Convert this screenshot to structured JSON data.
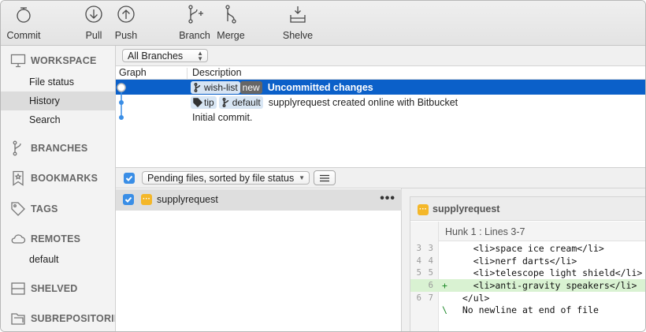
{
  "toolbar": {
    "commit": "Commit",
    "pull": "Pull",
    "push": "Push",
    "branch": "Branch",
    "merge": "Merge",
    "shelve": "Shelve"
  },
  "sidebar": {
    "workspace": "WORKSPACE",
    "file_status": "File status",
    "history": "History",
    "search": "Search",
    "branches": "BRANCHES",
    "bookmarks": "BOOKMARKS",
    "tags": "TAGS",
    "remotes": "REMOTES",
    "remote_default": "default",
    "shelved": "SHELVED",
    "subrepositories": "SUBREPOSITORIE"
  },
  "history": {
    "branch_filter": "All Branches",
    "col_graph": "Graph",
    "col_description": "Description",
    "rows": [
      {
        "tags": [
          "wish-list",
          "new"
        ],
        "message": "Uncommitted changes",
        "selected": true
      },
      {
        "tags": [
          "tip",
          "default"
        ],
        "message": "supplyrequest created online with Bitbucket",
        "selected": false
      },
      {
        "tags": [],
        "message": "Initial commit.",
        "selected": false
      }
    ]
  },
  "pending": {
    "filter_label": "Pending files, sorted by file status",
    "files": [
      {
        "name": "supplyrequest",
        "checked": true,
        "status": "modified",
        "menu": "•••"
      }
    ]
  },
  "diff": {
    "file": "supplyrequest",
    "hunk": "Hunk 1 : Lines 3-7",
    "lines": [
      {
        "old": "3",
        "new": "3",
        "mark": "",
        "code": "    <li>space ice cream</li>",
        "type": "ctx"
      },
      {
        "old": "4",
        "new": "4",
        "mark": "",
        "code": "    <li>nerf darts</li>",
        "type": "ctx"
      },
      {
        "old": "5",
        "new": "5",
        "mark": "",
        "code": "    <li>telescope light shield</li>",
        "type": "ctx"
      },
      {
        "old": "",
        "new": "6",
        "mark": "+",
        "code": "    <li>anti-gravity speakers</li>",
        "type": "add"
      },
      {
        "old": "6",
        "new": "7",
        "mark": "",
        "code": "  </ul>",
        "type": "ctx"
      },
      {
        "old": "",
        "new": "",
        "mark": "\\",
        "code": "  No newline at end of file",
        "type": "meta"
      }
    ]
  },
  "colors": {
    "selection": "#0b60c9",
    "checkbox": "#3a8ee6",
    "modified": "#f4b729",
    "added_line": "#d9f2d2",
    "graph": "#3a8ee6"
  }
}
